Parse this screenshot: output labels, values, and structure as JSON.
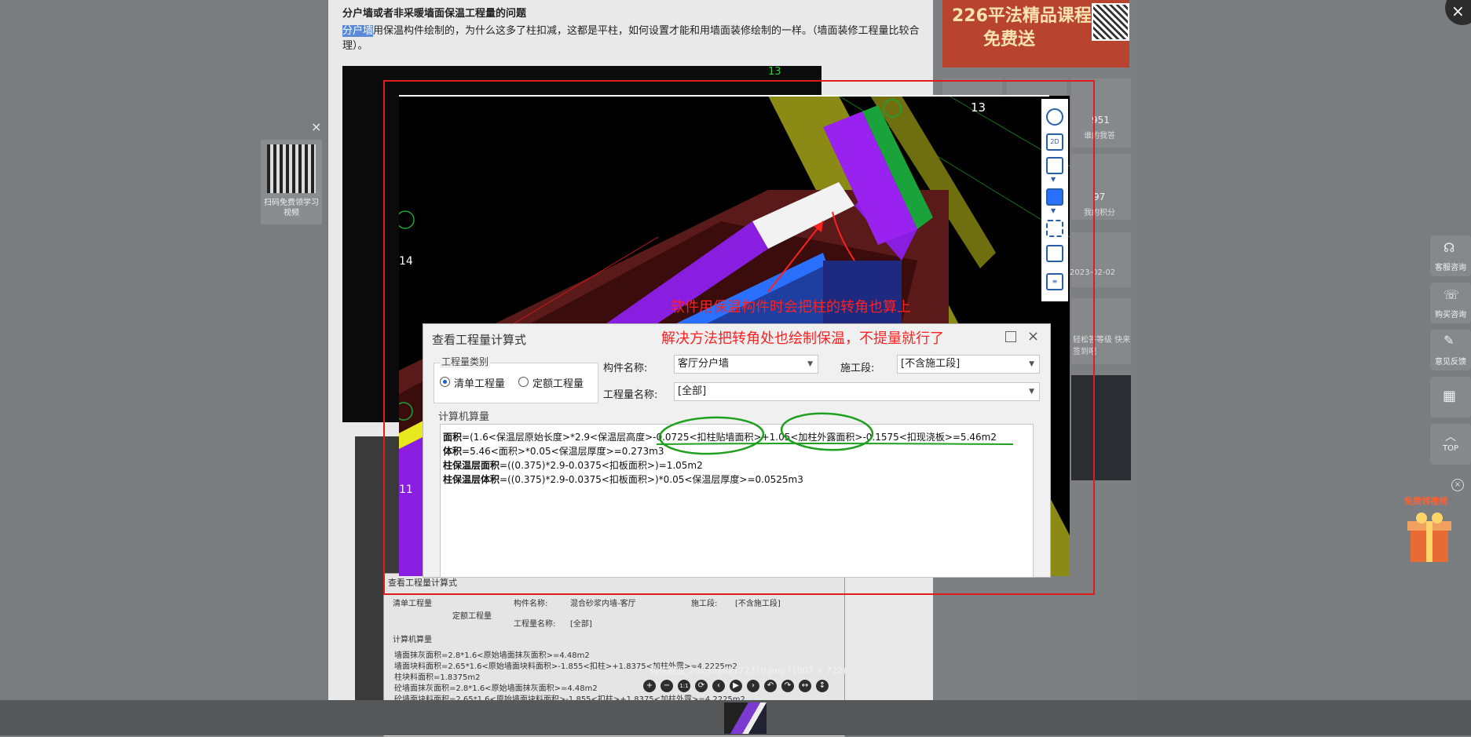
{
  "background_page": {
    "title": "分户墙或者非采暖墙面保温工程量的问题",
    "desc_highlight": "分户墙",
    "desc_rest": "用保温构件绘制的，为什么这多了柱扣减，这都是平柱，如何设置才能和用墙面装修绘制的一样。（墙面装修工程量比较合理）。",
    "bg_dialog_title": "查看工程量计算式",
    "bg_dialog_member_label": "构件名称:",
    "bg_dialog_member_value": "混合砂浆内墙-客厅",
    "bg_dialog_stage_label": "施工段:",
    "bg_dialog_stage_value": "[不含施工段]",
    "bg_dialog_qty_label": "工程量名称:",
    "bg_dialog_qty_value": "[全部]",
    "bg_dialog_radio1": "清单工程量",
    "bg_dialog_radio2": "定额工程量",
    "bg_dialog_calc_label": "计算机算量",
    "bg_lines": [
      "墙面抹灰面积=2.8*1.6<原始墙面抹灰面积>=4.48m2",
      "墙面块料面积=2.65*1.6<原始墙面块料面积>-1.855<扣柱>+1.8375<加柱外露>=4.2225m2",
      "柱块料面积=1.8375m2",
      "砼墙面抹灰面积=2.8*1.6<原始墙面抹灰面积>=4.48m2",
      "砼墙面块料面积=2.65*1.6<原始墙面块料面积>-1.855<扣柱>+1.8375<加柱外露>=4.2225m2"
    ],
    "tick_13": "13"
  },
  "right_column": {
    "ad_line1": "226平法精品课程",
    "ad_line2": "免费送",
    "stat1_num": "951",
    "stat1_label": "谁的我答",
    "stat2_num": "97",
    "stat2_label": "我的积分",
    "date": "2023-02-02",
    "note": "轻松答等级 快来签到吧"
  },
  "left_qr": {
    "text": "扫码免费领学习视频"
  },
  "side_buttons": [
    {
      "label": "客服咨询"
    },
    {
      "label": "购买咨询"
    },
    {
      "label": "意见反馈"
    },
    {
      "label": ""
    },
    {
      "label": "TOP"
    }
  ],
  "gift": {
    "label": "免费领视频"
  },
  "viewer": {
    "caption": "微信截图_20230202172310.png (1007 × 722)",
    "controls": [
      "+",
      "−",
      "1:1",
      "⟳",
      "‹",
      "▶",
      "›",
      "↶",
      "↷",
      "↔",
      "↕"
    ],
    "close": "×"
  },
  "cad": {
    "axis_13": "13",
    "axis_14": "14",
    "axis_11": "11",
    "annotation_1": "软件用保温构件时会把柱的转角也算上",
    "annotation_2": "解决方法把转角处也绘制保温，不提量就行了"
  },
  "dialog": {
    "title": "查看工程量计算式",
    "group_type_label": "工程量类别",
    "radio_bill": "清单工程量",
    "radio_quota": "定额工程量",
    "member_label": "构件名称:",
    "member_value": "客厅分户墙",
    "stage_label": "施工段:",
    "stage_value": "[不含施工段]",
    "qty_label": "工程量名称:",
    "qty_value": "[全部]",
    "calc_label": "计算机算量",
    "lines": [
      {
        "key": "面积",
        "expr": "=(1.6<保温层原始长度>*2.9<保温层高度>-0.0725<扣柱贴墙面积>+1.05<加柱外露面积>-0.1575<扣现浇板>=5.46m2"
      },
      {
        "key": "体积",
        "expr": "=5.46<面积>*0.05<保温层厚度>=0.273m3"
      },
      {
        "key": "柱保温层面积",
        "expr": "=((0.375)*2.9-0.0375<扣板面积>)=1.05m2"
      },
      {
        "key": "柱保温层体积",
        "expr": "=((0.375)*2.9-0.0375<扣板面积>)*0.05<保温层厚度>=0.0525m3"
      }
    ]
  },
  "colors": {
    "annotation_red": "#ff2020",
    "frame_red": "#e21c1c",
    "circle_green": "#1fa01f",
    "wall_purple": "#8a1ee0",
    "wall_yellow": "#e8e81e",
    "column_blue": "#1e3fa0",
    "olive": "#8a8a14"
  }
}
